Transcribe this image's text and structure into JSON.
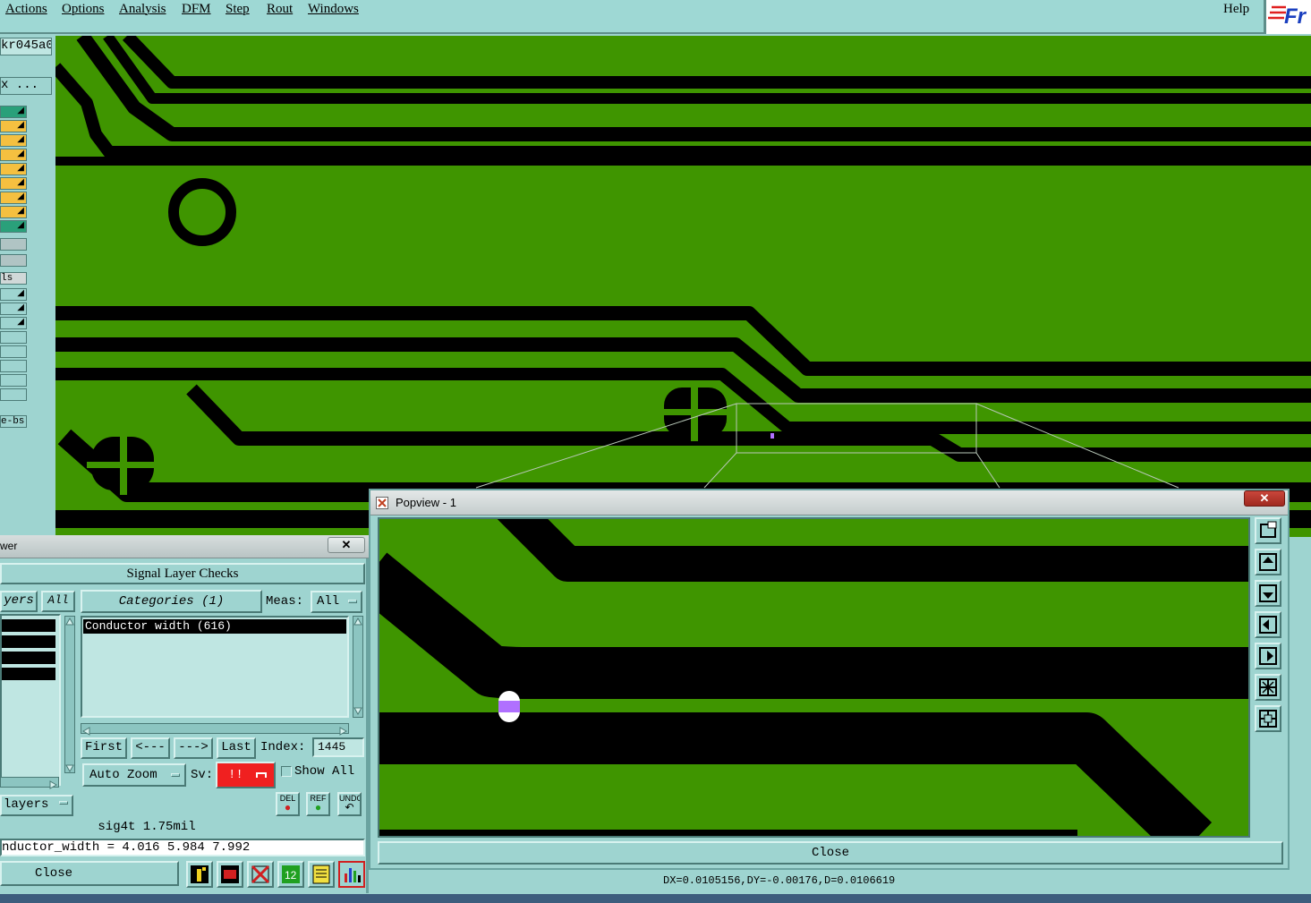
{
  "menubar": {
    "items": [
      "Actions",
      "Options",
      "Analysis",
      "DFM",
      "Step",
      "Rout",
      "Windows"
    ],
    "help": "Help",
    "logo_text": "Fr"
  },
  "leftpanel": {
    "job_field": "kr045a0",
    "filter_field": "x ...",
    "rows": [
      "",
      "",
      "",
      "",
      "",
      "",
      "",
      "",
      "",
      "",
      "",
      "ls",
      "",
      "",
      "",
      "",
      "",
      "",
      "",
      "",
      "e-bs"
    ]
  },
  "popview": {
    "title": "Popview - 1",
    "close_label": "Close"
  },
  "reporter": {
    "title": "wer",
    "header": "Signal Layer Checks",
    "layers_label": "yers",
    "all_label": "All",
    "categories_label": "Categories (1)",
    "meas_label": "Meas:",
    "meas_value": "All",
    "category_item": "Conductor width (616)",
    "first_label": "First",
    "prev_label": "<---",
    "next_label": "--->",
    "last_label": "Last",
    "index_label": "Index:",
    "index_value": "1445",
    "auto_zoom_label": "Auto Zoom",
    "sv_label": "Sv:",
    "sv_value": "!!",
    "show_all_label": "Show All",
    "layers_menu_label": "layers",
    "del_label": "DEL",
    "ref_label": "REF",
    "undo_label": "UNDO",
    "layer_info": "sig4t 1.75mil",
    "measure_info": "nductor_width = 4.016 5.984 7.992",
    "close_label": "Close"
  },
  "status": {
    "measure": "DX=0.0105156,DY=-0.00176,D=0.0106619"
  },
  "colors": {
    "panel_bg": "#9ed4d0",
    "copper": "#3f9500",
    "trace": "#000000",
    "severity_red": "#f02020",
    "marker": "#b070ff"
  }
}
